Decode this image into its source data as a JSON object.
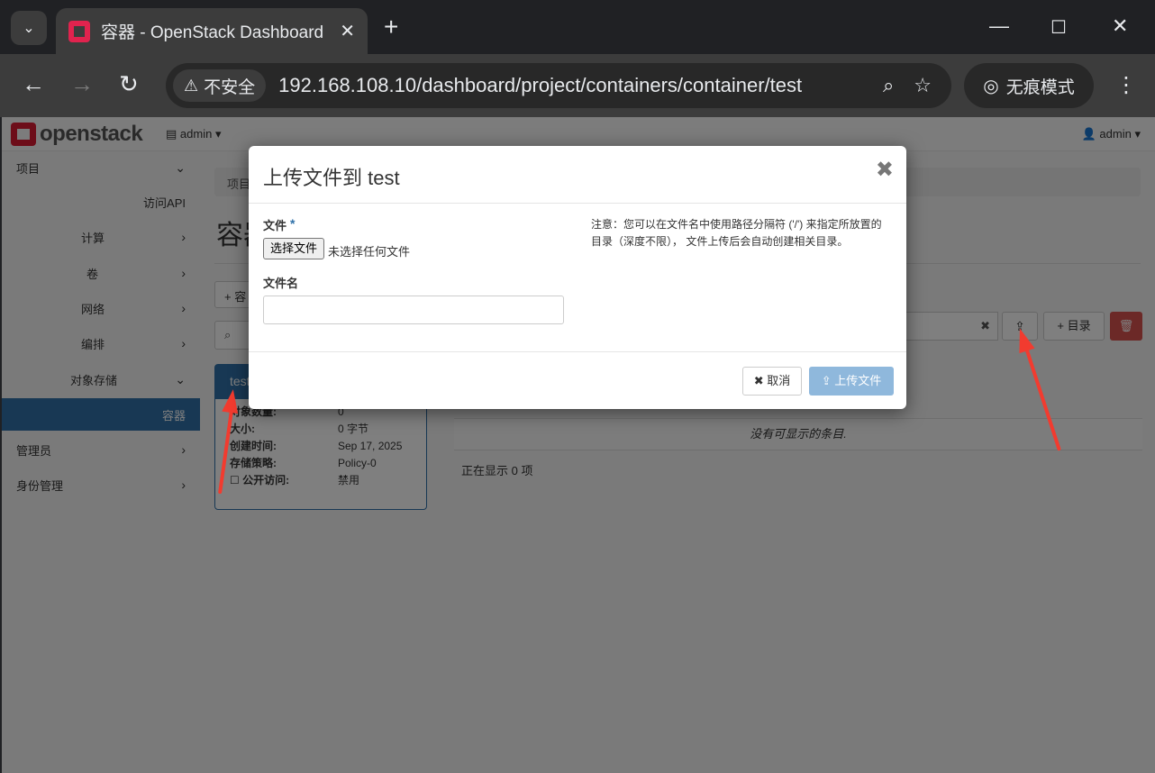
{
  "browser": {
    "tab_title": "容器 - OpenStack Dashboard",
    "security_label": "不安全",
    "url": "192.168.108.10/dashboard/project/containers/container/test",
    "incognito_label": "无痕模式"
  },
  "topbar": {
    "brand": "openstack",
    "project": "admin",
    "user": "admin"
  },
  "sidebar": {
    "items": [
      {
        "label": "项目"
      },
      {
        "label": "访问API"
      },
      {
        "label": "计算"
      },
      {
        "label": "卷"
      },
      {
        "label": "网络"
      },
      {
        "label": "编排"
      },
      {
        "label": "对象存储"
      },
      {
        "label": "容器"
      },
      {
        "label": "管理员"
      },
      {
        "label": "身份管理"
      }
    ]
  },
  "main": {
    "breadcrumb": "项目",
    "title": "容器",
    "create_button": "容",
    "folder_button": "目录",
    "container": {
      "name": "test",
      "object_count_label": "对象数量:",
      "object_count": "0",
      "size_label": "大小:",
      "size": "0 字节",
      "created_label": "创建时间:",
      "created": "Sep 17, 2025",
      "policy_label": "存储策略:",
      "policy": "Policy-0",
      "public_label": "公开访问:",
      "public": "禁用"
    },
    "table_empty": "没有可显示的条目.",
    "table_count": "正在显示 0 项"
  },
  "modal": {
    "title": "上传文件到 test",
    "file_label": "文件",
    "required_mark": "*",
    "choose_file": "选择文件",
    "no_file": "未选择任何文件",
    "filename_label": "文件名",
    "filename_value": "",
    "note": "注意：您可以在文件名中使用路径分隔符 ('/') 来指定所放置的目录（深度不限）， 文件上传后会自动创建相关目录。",
    "cancel": "取消",
    "submit": "上传文件"
  },
  "colors": {
    "accent": "#3071a9",
    "danger": "#d9534f",
    "annotation_arrow": "#f23b2f"
  }
}
